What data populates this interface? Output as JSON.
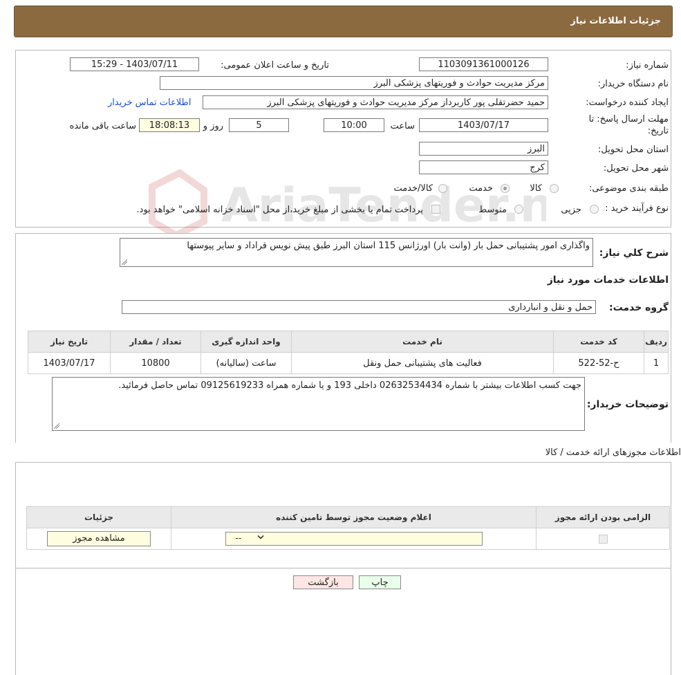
{
  "header": {
    "title": "جزئیات اطلاعات نیاز"
  },
  "form": {
    "need_number_label": "شماره نیاز:",
    "need_number": "1103091361000126",
    "announce_label": "تاریخ و ساعت اعلان عمومی:",
    "announce_value": "1403/07/11 - 15:29",
    "buyer_label": "نام دستگاه خریدار:",
    "buyer_value": "مرکز مدیریت حوادث و فوریتهای پزشکی البرز",
    "creator_label": "ایجاد کننده درخواست:",
    "creator_value": "حمید حضرتقلی پور کاربرداز  مرکز مدیریت حوادث و فوریتهای پزشکی البرز",
    "contact_link": "اطلاعات تماس خریدار",
    "deadline_label_1": "مهلت ارسال پاسخ: تا",
    "deadline_label_2": "تاریخ:",
    "deadline_date": "1403/07/17",
    "time_label": "ساعت",
    "deadline_time": "10:00",
    "days_value": "5",
    "days_label": "روز و",
    "remaining_time": "18:08:13",
    "remaining_label": "ساعت باقی مانده",
    "province_label": "استان محل تحویل:",
    "province_value": "البرز",
    "city_label": "شهر محل تحویل:",
    "city_value": "کرج",
    "category_label": "طبقه بندی موضوعی:",
    "category_options": [
      "کالا",
      "خدمت",
      "کالا/خدمت"
    ],
    "category_selected": "خدمت",
    "process_label": "نوع فرآیند خرید :",
    "process_options": [
      "جزیی",
      "متوسط"
    ],
    "payment_note": "پرداخت تمام یا بخشی از مبلغ خرید،از محل \"اسناد خزانه اسلامی\" خواهد بود."
  },
  "summary": {
    "label": "شرح کلي نياز:",
    "value": "واگذاری امور پشتیبانی حمل بار (وانت بار) اورژانس 115 استان البرز طبق پیش نویس قراداد و سایر پیوستها"
  },
  "services": {
    "section_title": "اطلاعات خدمات مورد نیاز",
    "group_label": "گروه خدمت:",
    "group_value": "حمل و نقل و انبارداری",
    "columns": [
      "ردیف",
      "کد خدمت",
      "نام خدمت",
      "واحد اندازه گیری",
      "تعداد / مقدار",
      "تاریخ نیاز"
    ],
    "rows": [
      [
        "1",
        "ح-52-522",
        "فعالیت های پشتیبانی حمل ونقل",
        "ساعت (سالیانه)",
        "10800",
        "1403/07/17"
      ]
    ]
  },
  "buyer_notes": {
    "label": "توضیحات خریدار:",
    "value": "جهت کسب اطلاعات بیشتر با شماره 02632534434 داخلی 193 و یا شماره همراه 09125619233 تماس حاصل فرمائید."
  },
  "permits": {
    "section_title": "اطلاعات مجوزهای ارائه خدمت / کالا",
    "columns": [
      "الزامی بودن ارائه مجوز",
      "اعلام وضعیت مجوز توسط تامین کننده",
      "جزئیات"
    ],
    "select_value": "--",
    "view_button": "مشاهده مجوز"
  },
  "buttons": {
    "print": "چاپ",
    "back": "بازگشت"
  },
  "watermark": {
    "text": "AriaTender.neT"
  }
}
